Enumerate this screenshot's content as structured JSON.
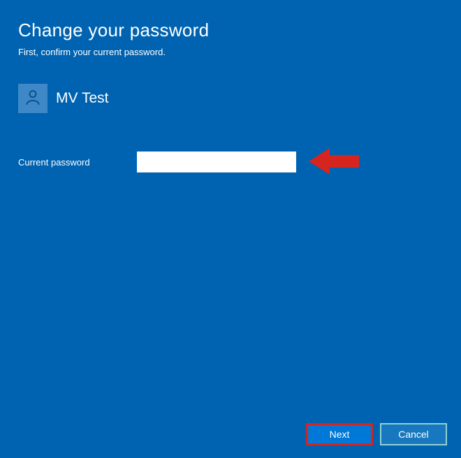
{
  "heading": {
    "title": "Change your password",
    "subtitle": "First, confirm your current password."
  },
  "user": {
    "name": "MV Test"
  },
  "form": {
    "current_password_label": "Current password",
    "current_password_value": ""
  },
  "buttons": {
    "next": "Next",
    "cancel": "Cancel"
  },
  "annotation": {
    "arrow_color": "#d6241f"
  }
}
